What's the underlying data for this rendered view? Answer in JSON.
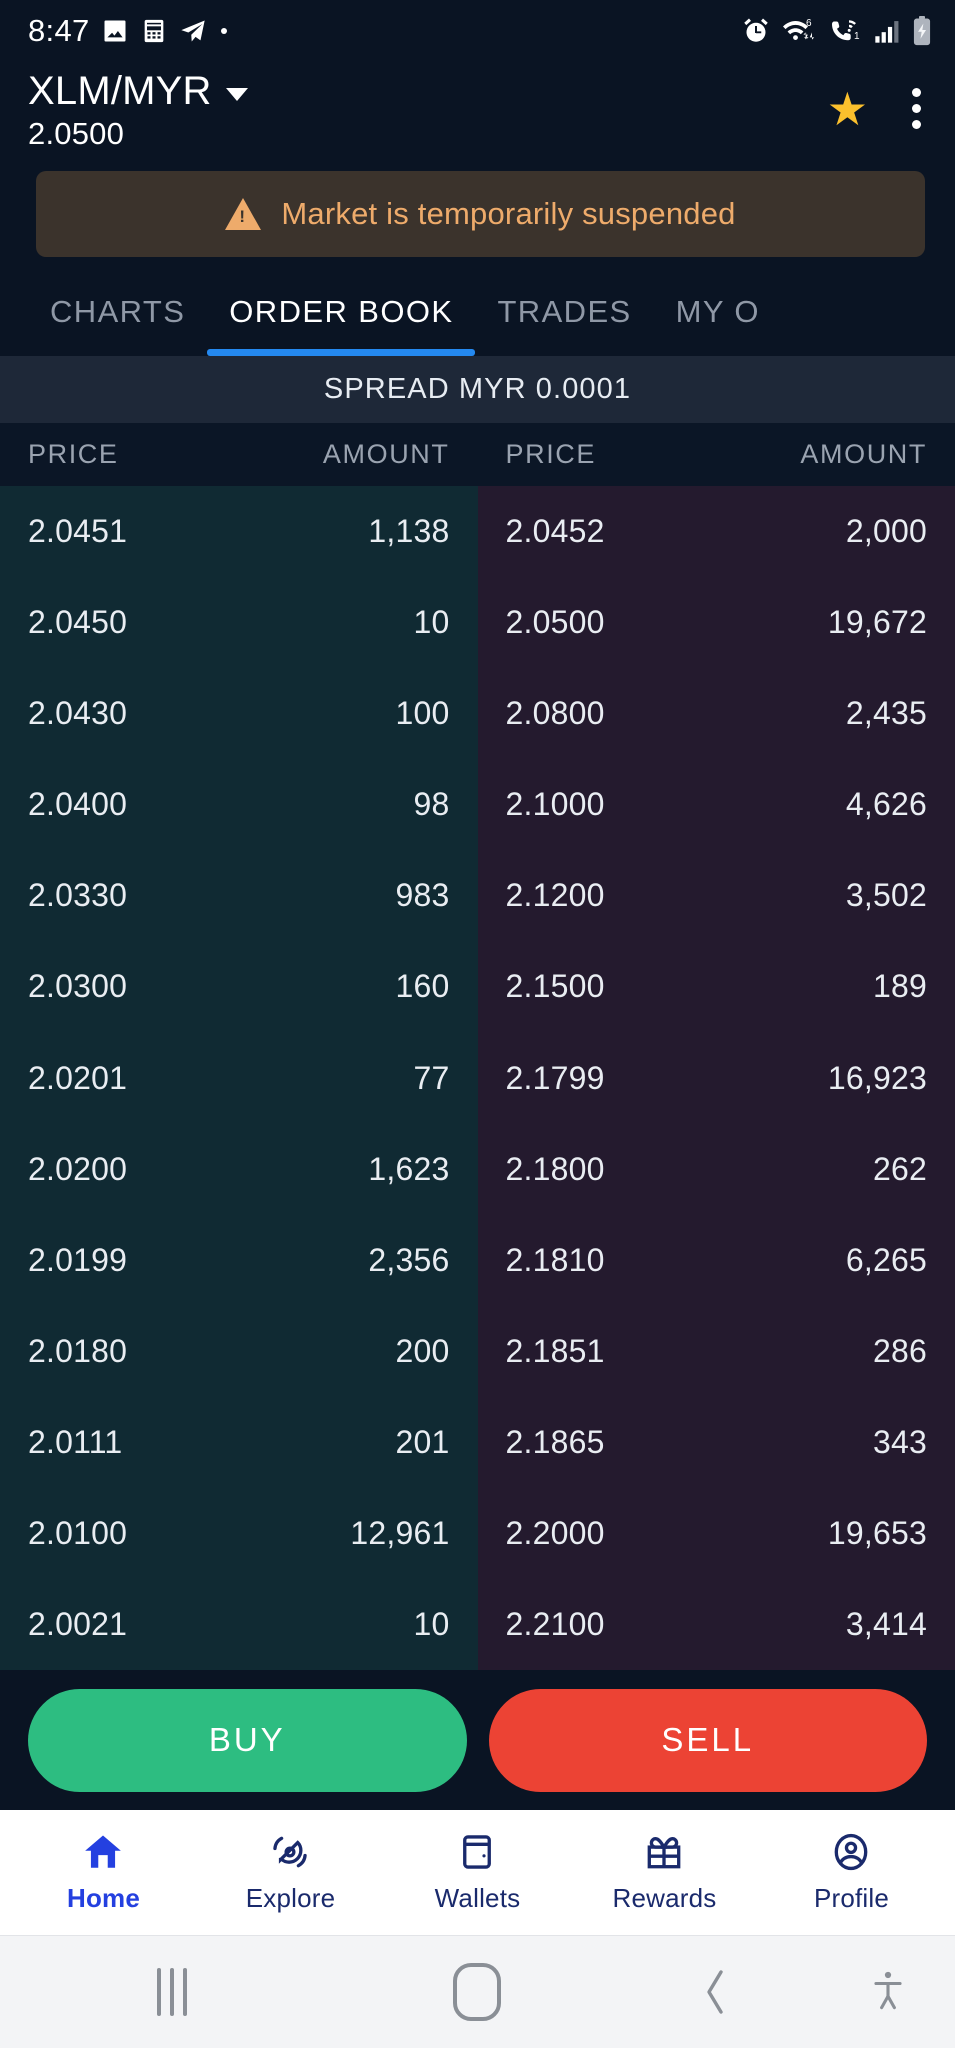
{
  "statusbar": {
    "time": "8:47",
    "left_icons": [
      "photo-icon",
      "calculator-icon",
      "telegram-icon",
      "dot-icon"
    ],
    "right_icons": [
      "alarm-icon",
      "wifi6-icon",
      "vowifi-call-icon",
      "signal-bars-icon",
      "battery-charging-icon"
    ]
  },
  "header": {
    "pair": "XLM/MYR",
    "price": "2.0500",
    "favorite_icon": "star-icon",
    "overflow_icon": "kebab-menu-icon",
    "dropdown_icon": "chevron-down-icon"
  },
  "banner": {
    "icon": "warning-triangle-icon",
    "text": "Market is temporarily suspended",
    "bg_color": "#3b332c",
    "text_color": "#eeab6b"
  },
  "tabs": {
    "items": [
      {
        "label": "CHARTS",
        "active": false
      },
      {
        "label": "ORDER BOOK",
        "active": true
      },
      {
        "label": "TRADES",
        "active": false
      },
      {
        "label": "MY O",
        "active": false
      }
    ],
    "active_color": "#2489f0"
  },
  "spread": {
    "label": "SPREAD MYR 0.0001"
  },
  "orderbook": {
    "bid_headers": {
      "price": "PRICE",
      "amount": "AMOUNT"
    },
    "ask_headers": {
      "price": "PRICE",
      "amount": "AMOUNT"
    },
    "bid_bg": "#102a33",
    "ask_bg": "#241a2e",
    "bids": [
      {
        "price": "2.0451",
        "amount": "1,138"
      },
      {
        "price": "2.0450",
        "amount": "10"
      },
      {
        "price": "2.0430",
        "amount": "100"
      },
      {
        "price": "2.0400",
        "amount": "98"
      },
      {
        "price": "2.0330",
        "amount": "983"
      },
      {
        "price": "2.0300",
        "amount": "160"
      },
      {
        "price": "2.0201",
        "amount": "77"
      },
      {
        "price": "2.0200",
        "amount": "1,623"
      },
      {
        "price": "2.0199",
        "amount": "2,356"
      },
      {
        "price": "2.0180",
        "amount": "200"
      },
      {
        "price": "2.0111",
        "amount": "201"
      },
      {
        "price": "2.0100",
        "amount": "12,961"
      },
      {
        "price": "2.0021",
        "amount": "10"
      }
    ],
    "asks": [
      {
        "price": "2.0452",
        "amount": "2,000"
      },
      {
        "price": "2.0500",
        "amount": "19,672"
      },
      {
        "price": "2.0800",
        "amount": "2,435"
      },
      {
        "price": "2.1000",
        "amount": "4,626"
      },
      {
        "price": "2.1200",
        "amount": "3,502"
      },
      {
        "price": "2.1500",
        "amount": "189"
      },
      {
        "price": "2.1799",
        "amount": "16,923"
      },
      {
        "price": "2.1800",
        "amount": "262"
      },
      {
        "price": "2.1810",
        "amount": "6,265"
      },
      {
        "price": "2.1851",
        "amount": "286"
      },
      {
        "price": "2.1865",
        "amount": "343"
      },
      {
        "price": "2.2000",
        "amount": "19,653"
      },
      {
        "price": "2.2100",
        "amount": "3,414"
      }
    ]
  },
  "actions": {
    "buy_label": "BUY",
    "sell_label": "SELL",
    "buy_color": "#2dbd81",
    "sell_color": "#ec4334"
  },
  "bottomnav": {
    "items": [
      {
        "label": "Home",
        "icon": "home-icon",
        "active": true
      },
      {
        "label": "Explore",
        "icon": "explore-icon",
        "active": false
      },
      {
        "label": "Wallets",
        "icon": "wallet-icon",
        "active": false
      },
      {
        "label": "Rewards",
        "icon": "gift-icon",
        "active": false
      },
      {
        "label": "Profile",
        "icon": "profile-icon",
        "active": false
      }
    ],
    "active_color": "#2440e0",
    "inactive_color": "#1a2a6c"
  },
  "sysnav": {
    "recents_icon": "recents-icon",
    "home_icon": "home-square-icon",
    "back_icon": "back-chevron-icon",
    "accessibility_icon": "accessibility-icon"
  }
}
